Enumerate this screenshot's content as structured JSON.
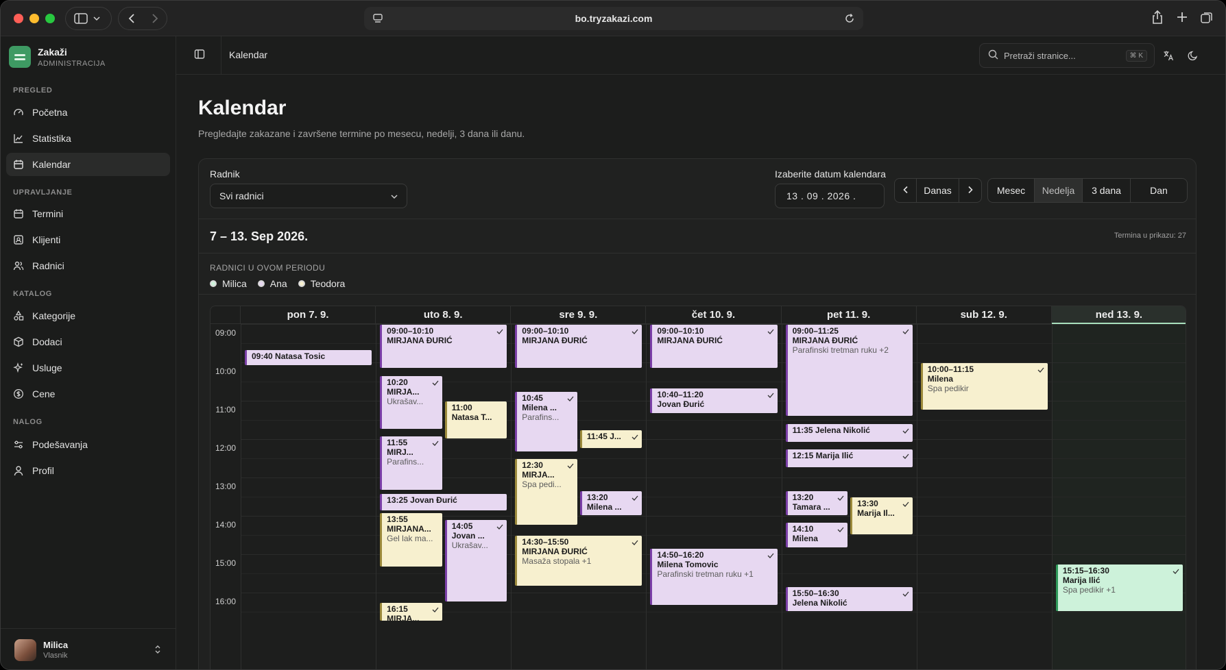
{
  "browser": {
    "url": "bo.tryzakazi.com"
  },
  "brand": {
    "name": "Zakaži",
    "subtitle": "ADMINISTRACIJA"
  },
  "sidebar": {
    "sections": [
      {
        "title": "PREGLED",
        "items": [
          {
            "label": "Početna",
            "icon": "gauge-icon"
          },
          {
            "label": "Statistika",
            "icon": "chart-icon"
          },
          {
            "label": "Kalendar",
            "icon": "calendar-icon",
            "active": true
          }
        ]
      },
      {
        "title": "UPRAVLJANJE",
        "items": [
          {
            "label": "Termini",
            "icon": "calendar-icon"
          },
          {
            "label": "Klijenti",
            "icon": "contact-icon"
          },
          {
            "label": "Radnici",
            "icon": "users-icon"
          }
        ]
      },
      {
        "title": "KATALOG",
        "items": [
          {
            "label": "Kategorije",
            "icon": "shapes-icon"
          },
          {
            "label": "Dodaci",
            "icon": "box-icon"
          },
          {
            "label": "Usluge",
            "icon": "sparkle-icon"
          },
          {
            "label": "Cene",
            "icon": "dollar-icon"
          }
        ]
      },
      {
        "title": "NALOG",
        "items": [
          {
            "label": "Podešavanja",
            "icon": "sliders-icon"
          },
          {
            "label": "Profil",
            "icon": "user-icon"
          }
        ]
      }
    ],
    "user": {
      "name": "Milica",
      "role": "Vlasnik"
    }
  },
  "topbar": {
    "breadcrumb": "Kalendar",
    "search_placeholder": "Pretraži stranice...",
    "search_shortcut": "⌘ K"
  },
  "page": {
    "title": "Kalendar",
    "description": "Pregledajte zakazane i završene termine po mesecu, nedelji, 3 dana ili danu."
  },
  "filters": {
    "worker_label": "Radnik",
    "worker_value": "Svi radnici",
    "date_label": "Izaberite datum kalendara",
    "date_value": "13 . 09 . 2026 .",
    "today_label": "Danas",
    "views": [
      "Mesec",
      "Nedelja",
      "3 dana",
      "Dan"
    ],
    "selected_view": "Nedelja"
  },
  "period": {
    "title": "7 – 13. Sep 2026.",
    "count_label": "Termina u prikazu: 27",
    "workers_title": "RADNICI U OVOM PERIODU",
    "workers": [
      {
        "name": "Milica",
        "color": "#cdf2da"
      },
      {
        "name": "Ana",
        "color": "#e7d8f1"
      },
      {
        "name": "Teodora",
        "color": "#f7f0cf"
      }
    ]
  },
  "calendar": {
    "days": [
      "pon 7. 9.",
      "uto 8. 9.",
      "sre 9. 9.",
      "čet 10. 9.",
      "pet 11. 9.",
      "sub 12. 9.",
      "ned 13. 9."
    ],
    "today_index": 6,
    "hours": [
      "09:00",
      "10:00",
      "11:00",
      "12:00",
      "13:00",
      "14:00",
      "15:00",
      "16:00"
    ],
    "events": [
      {
        "day": 0,
        "start": "09:40",
        "end": "10:05",
        "lane": 0,
        "lanes": 1,
        "color": "p",
        "title": "09:40 Natasa Tosic",
        "single": true,
        "check": false
      },
      {
        "day": 1,
        "start": "09:00",
        "end": "10:10",
        "lane": 0,
        "lanes": 1,
        "color": "p",
        "title": "09:00–10:10",
        "name": "MIRJANA ĐURIĆ",
        "check": true
      },
      {
        "day": 1,
        "start": "10:20",
        "end": "11:45",
        "lane": 0,
        "lanes": 2,
        "color": "p",
        "title": "10:20",
        "name": "MIRJA...",
        "sub": "Ukrašav...",
        "check": true
      },
      {
        "day": 1,
        "start": "11:00",
        "end": "12:00",
        "lane": 1,
        "lanes": 2,
        "color": "y",
        "title": "11:00",
        "name": "Natasa T...",
        "check": false
      },
      {
        "day": 1,
        "start": "11:55",
        "end": "13:20",
        "lane": 0,
        "lanes": 2,
        "color": "p",
        "title": "11:55",
        "name": "MIRJ...",
        "sub": "Parafins...",
        "check": true
      },
      {
        "day": 1,
        "start": "13:25",
        "end": "13:52",
        "lane": 0,
        "lanes": 1,
        "color": "p",
        "title": "13:25 Jovan Đurić",
        "single": true,
        "check": false
      },
      {
        "day": 1,
        "start": "13:55",
        "end": "15:20",
        "lane": 0,
        "lanes": 2,
        "color": "y",
        "title": "13:55",
        "name": "MIRJANA...",
        "sub": "Gel lak ma...",
        "check": false
      },
      {
        "day": 1,
        "start": "14:05",
        "end": "16:15",
        "lane": 1,
        "lanes": 2,
        "color": "p",
        "title": "14:05",
        "name": "Jovan ...",
        "sub": "Ukrašav...",
        "check": true
      },
      {
        "day": 1,
        "start": "16:15",
        "end": "16:45",
        "lane": 0,
        "lanes": 2,
        "color": "y",
        "title": "16:15",
        "name": "MIRJA...",
        "check": true
      },
      {
        "day": 2,
        "start": "09:00",
        "end": "10:10",
        "lane": 0,
        "lanes": 1,
        "color": "p",
        "title": "09:00–10:10",
        "name": "MIRJANA ĐURIĆ",
        "check": true
      },
      {
        "day": 2,
        "start": "10:45",
        "end": "12:20",
        "lane": 0,
        "lanes": 2,
        "color": "p",
        "title": "10:45",
        "name": "Milena ...",
        "sub": "Parafins...",
        "check": true
      },
      {
        "day": 2,
        "start": "11:45",
        "end": "12:15",
        "lane": 1,
        "lanes": 2,
        "color": "y",
        "title": "11:45 J...",
        "single": true,
        "check": true
      },
      {
        "day": 2,
        "start": "12:30",
        "end": "14:15",
        "lane": 0,
        "lanes": 2,
        "color": "y",
        "title": "12:30",
        "name": "MIRJA...",
        "sub": "Spa pedi...",
        "check": true
      },
      {
        "day": 2,
        "start": "13:20",
        "end": "14:00",
        "lane": 1,
        "lanes": 2,
        "color": "p",
        "title": "13:20",
        "name": "Milena ...",
        "check": true
      },
      {
        "day": 2,
        "start": "14:30",
        "end": "15:50",
        "lane": 0,
        "lanes": 1,
        "color": "y",
        "title": "14:30–15:50",
        "name": "MIRJANA ĐURIĆ",
        "sub": "Masaža stopala +1",
        "check": true
      },
      {
        "day": 3,
        "start": "09:00",
        "end": "10:10",
        "lane": 0,
        "lanes": 1,
        "color": "p",
        "title": "09:00–10:10",
        "name": "MIRJANA ĐURIĆ",
        "check": true
      },
      {
        "day": 3,
        "start": "10:40",
        "end": "11:20",
        "lane": 0,
        "lanes": 1,
        "color": "p",
        "title": "10:40–11:20",
        "name": "Jovan Đurić",
        "check": true
      },
      {
        "day": 3,
        "start": "14:50",
        "end": "16:20",
        "lane": 0,
        "lanes": 1,
        "color": "p",
        "title": "14:50–16:20",
        "name": "Milena Tomovic",
        "sub": "Parafinski tretman ruku +1",
        "check": true
      },
      {
        "day": 4,
        "start": "09:00",
        "end": "11:25",
        "lane": 0,
        "lanes": 1,
        "color": "p",
        "title": "09:00–11:25",
        "name": "MIRJANA ĐURIĆ",
        "sub": "Parafinski tretman ruku +2",
        "check": true
      },
      {
        "day": 4,
        "start": "11:35",
        "end": "12:05",
        "lane": 0,
        "lanes": 1,
        "color": "p",
        "title": "11:35 Jelena Nikolić",
        "single": true,
        "check": true
      },
      {
        "day": 4,
        "start": "12:15",
        "end": "12:45",
        "lane": 0,
        "lanes": 1,
        "color": "p",
        "title": "12:15 Marija Ilić",
        "single": true,
        "check": true
      },
      {
        "day": 4,
        "start": "13:20",
        "end": "14:00",
        "lane": 0,
        "lanes": 2,
        "color": "p",
        "title": "13:20",
        "name": "Tamara ...",
        "check": true
      },
      {
        "day": 4,
        "start": "13:30",
        "end": "14:30",
        "lane": 1,
        "lanes": 2,
        "color": "y",
        "title": "13:30",
        "name": "Marija Il...",
        "check": true
      },
      {
        "day": 4,
        "start": "14:10",
        "end": "14:50",
        "lane": 0,
        "lanes": 2,
        "color": "p",
        "title": "14:10",
        "name": "Milena",
        "check": true
      },
      {
        "day": 4,
        "start": "15:50",
        "end": "16:30",
        "lane": 0,
        "lanes": 1,
        "color": "p",
        "title": "15:50–16:30",
        "name": "Jelena Nikolić",
        "check": true
      },
      {
        "day": 5,
        "start": "10:00",
        "end": "11:15",
        "lane": 0,
        "lanes": 1,
        "color": "y",
        "title": "10:00–11:15",
        "name": "Milena",
        "sub": "Spa pedikir",
        "check": true
      },
      {
        "day": 6,
        "start": "15:15",
        "end": "16:30",
        "lane": 0,
        "lanes": 1,
        "color": "g",
        "title": "15:15–16:30",
        "name": "Marija Ilić",
        "sub": "Spa pedikir +1",
        "check": true
      }
    ]
  }
}
